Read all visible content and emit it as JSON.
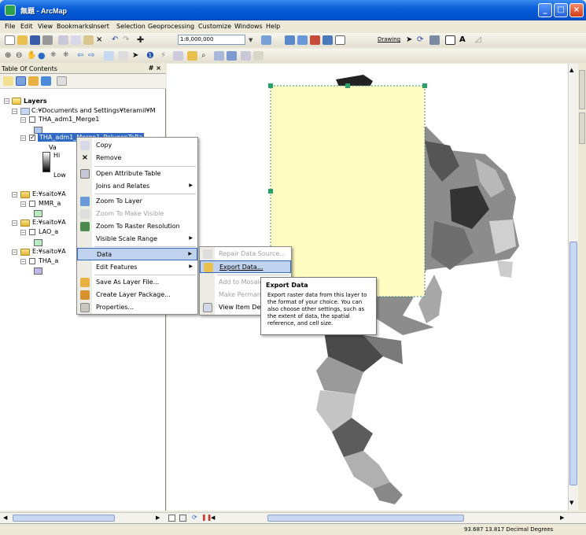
{
  "window": {
    "title": "無題 - ArcMap"
  },
  "menubar": [
    "File",
    "Edit",
    "View",
    "Bookmarks",
    "Insert",
    "Selection",
    "Geoprocessing",
    "Customize",
    "Windows",
    "Help"
  ],
  "toolbar": {
    "scale": "1:8,000,000",
    "drawing_label": "Drawing"
  },
  "toc": {
    "title": "Table Of Contents",
    "pin": "# ×",
    "layers_label": "Layers",
    "folder1": "C:¥Documents and Settings¥teramil¥M",
    "layer1": "THA_adm1_Merge1",
    "selected_layer": "THA_adm1_Merge1_PolygonToRa",
    "value_label": "Va",
    "high_label": "Hi",
    "low_label": "Low",
    "folder2": "E:¥saito¥A",
    "layer2": "MMR_a",
    "folder3": "E:¥saito¥A",
    "layer3": "LAO_a",
    "folder4": "E:¥saito¥A",
    "layer4": "THA_a"
  },
  "context_menu": {
    "items": [
      "Copy",
      "Remove",
      "Open Attribute Table",
      "Joins and Relates",
      "Zoom To Layer",
      "Zoom To Make Visible",
      "Zoom To Raster Resolution",
      "Visible Scale Range",
      "Data",
      "Edit Features",
      "Save As Layer File...",
      "Create Layer Package...",
      "Properties..."
    ]
  },
  "submenu": {
    "items": [
      "Repair Data Source...",
      "Export Data...",
      "Add to Mosaic ...",
      "Make Permanent",
      "View Item Description"
    ]
  },
  "tooltip": {
    "title": "Export Data",
    "body": "Export raster data from this layer to the format of your choice. You can also choose other settings, such as the extent of data, the spatial reference, and cell size."
  },
  "status": {
    "coordinates": "93.687  13.817 Decimal Degrees"
  },
  "colors": {
    "title_blue": "#0052cc",
    "highlight": "#c1d2ee",
    "frame_fill": "#fffdc2"
  }
}
